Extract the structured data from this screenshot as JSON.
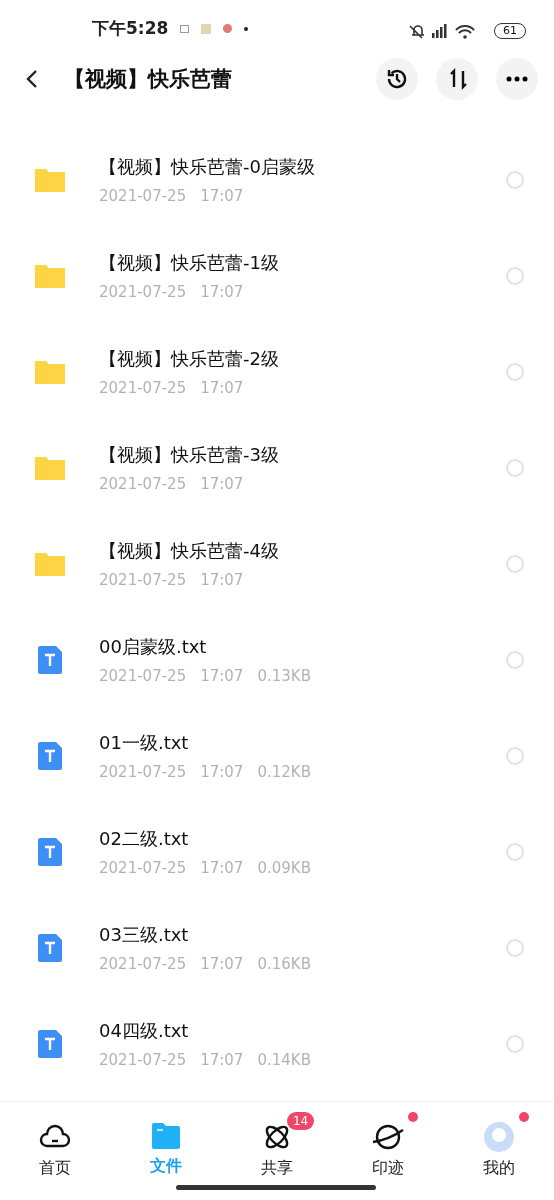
{
  "status_bar": {
    "time": "下午5:28",
    "battery": "61"
  },
  "header": {
    "title": "【视频】快乐芭蕾"
  },
  "files": [
    {
      "kind": "folder",
      "name": "【视频】快乐芭蕾-0启蒙级",
      "date": "2021-07-25",
      "time": "17:07",
      "selected": false
    },
    {
      "kind": "folder",
      "name": "【视频】快乐芭蕾-1级",
      "date": "2021-07-25",
      "time": "17:07",
      "selected": false
    },
    {
      "kind": "folder",
      "name": "【视频】快乐芭蕾-2级",
      "date": "2021-07-25",
      "time": "17:07",
      "selected": false
    },
    {
      "kind": "folder",
      "name": "【视频】快乐芭蕾-3级",
      "date": "2021-07-25",
      "time": "17:07",
      "selected": false
    },
    {
      "kind": "folder",
      "name": "【视频】快乐芭蕾-4级",
      "date": "2021-07-25",
      "time": "17:07",
      "selected": false
    },
    {
      "kind": "text",
      "name": "00启蒙级.txt",
      "date": "2021-07-25",
      "time": "17:07",
      "size": "0.13KB",
      "selected": false
    },
    {
      "kind": "text",
      "name": "01一级.txt",
      "date": "2021-07-25",
      "time": "17:07",
      "size": "0.12KB",
      "selected": false
    },
    {
      "kind": "text",
      "name": "02二级.txt",
      "date": "2021-07-25",
      "time": "17:07",
      "size": "0.09KB",
      "selected": false
    },
    {
      "kind": "text",
      "name": "03三级.txt",
      "date": "2021-07-25",
      "time": "17:07",
      "size": "0.16KB",
      "selected": false
    },
    {
      "kind": "text",
      "name": "04四级.txt",
      "date": "2021-07-25",
      "time": "17:07",
      "size": "0.14KB",
      "selected": false
    }
  ],
  "nav": [
    {
      "kind": "home",
      "label": "首页",
      "selected": false,
      "dot": false
    },
    {
      "kind": "files",
      "label": "文件",
      "selected": true,
      "dot": false
    },
    {
      "kind": "share",
      "label": "共享",
      "selected": false,
      "badge": "14",
      "dot": false
    },
    {
      "kind": "planet",
      "label": "印迹",
      "selected": false,
      "dot": true
    },
    {
      "kind": "avatar",
      "label": "我的",
      "selected": false,
      "dot": true
    }
  ]
}
